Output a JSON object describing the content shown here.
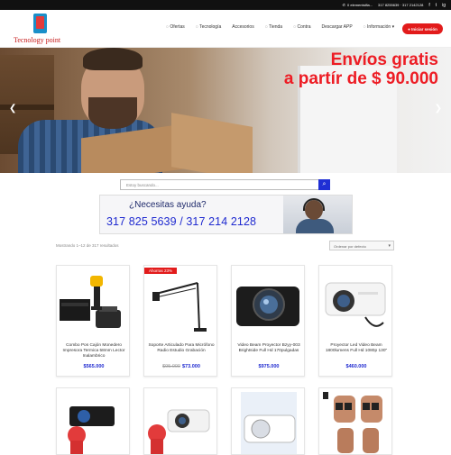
{
  "topbar": {
    "email": "0 elementsifia...",
    "phones": "317 8255639 · 317 2142128",
    "social": [
      "f",
      "t",
      "ig"
    ]
  },
  "header": {
    "logo_text": "Tecnology point",
    "nav": [
      "Ofertas",
      "Tecnología",
      "Accesorios",
      "Tienda",
      "Contra",
      "Descargar APP",
      "Información"
    ],
    "login_label": "Iniciar sesión"
  },
  "hero": {
    "line1": "Envíos gratis",
    "line2": "a partír de $ 90.000"
  },
  "search": {
    "placeholder": "Estoy buscando...",
    "icon": "search-icon"
  },
  "help": {
    "question": "¿Necesitas ayuda?",
    "phones": "317 825 5639 / 317 214 2128"
  },
  "shop": {
    "results": "Mostrando 1–12 de 317 resultados",
    "sort": "Ordenar por defecto"
  },
  "products": [
    {
      "name": "Combo Pos Cajón Monedero Impresora Termica 58mm Lector Inalambrico",
      "price": "$565.000",
      "old_price": "",
      "badge": ""
    },
    {
      "name": "Soporte Articulado Para Micrófono Radio Estudio Grabación",
      "price": "$73.000",
      "old_price": "$95.000",
      "badge": "Ahorras 23%"
    },
    {
      "name": "Video Beam Proyector Bzyy-003 Brightside Full Hd 170pulgadas",
      "price": "$975.000",
      "old_price": "",
      "badge": ""
    },
    {
      "name": "Proyector Led Video Beam 1800lumens Full Hd 1080p 130\"",
      "price": "$460.000",
      "old_price": "",
      "badge": ""
    }
  ],
  "colors": {
    "accent": "#e21b1b",
    "blue": "#1f2ad0",
    "promo": "#ed1c24"
  }
}
